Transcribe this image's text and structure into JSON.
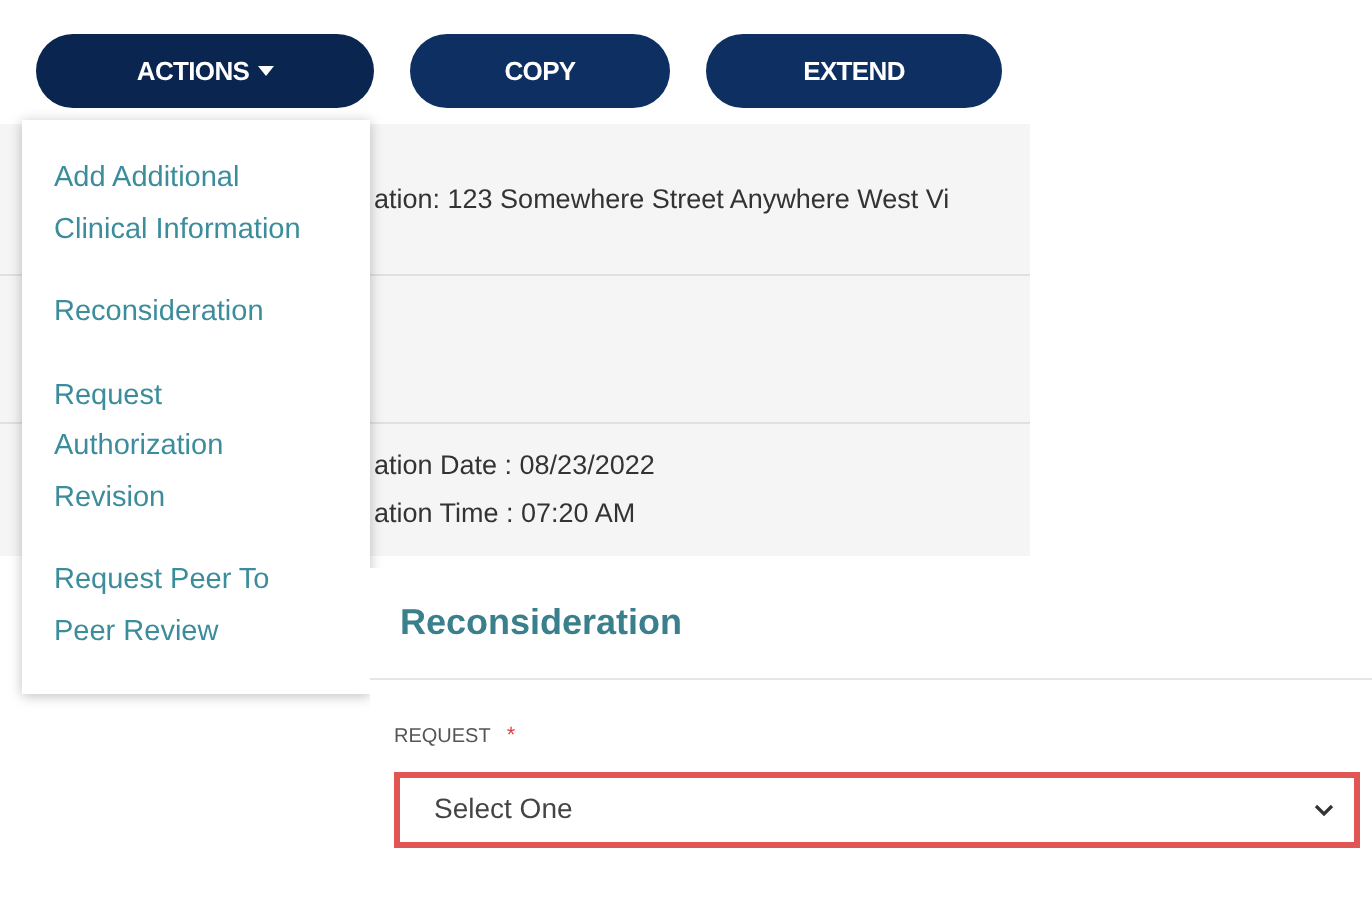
{
  "toolbar": {
    "buttons": [
      {
        "label": "ACTIONS",
        "kind": "dropdown",
        "expanded": true
      },
      {
        "label": "COPY",
        "kind": "plain",
        "expanded": false
      },
      {
        "label": "EXTEND",
        "kind": "plain",
        "expanded": false
      }
    ]
  },
  "actions_menu": {
    "items": [
      {
        "label": "Add Additional Clinical Information"
      },
      {
        "label": "Reconsideration"
      },
      {
        "label": "Request Authorization Revision"
      },
      {
        "label": "Request Peer To Peer Review"
      }
    ]
  },
  "details": {
    "rows": [
      {
        "lines": [
          "ation: 123 Somewhere Street Anywhere West Vi"
        ]
      },
      {
        "lines": []
      },
      {
        "lines": [
          "ation Date : 08/23/2022",
          "ation Time : 07:20 AM"
        ]
      }
    ]
  },
  "reconsideration": {
    "title": "Reconsideration",
    "field": {
      "label": "REQUEST",
      "required_mark": "*",
      "required": true,
      "value": "Select One",
      "invalid": true
    }
  }
}
